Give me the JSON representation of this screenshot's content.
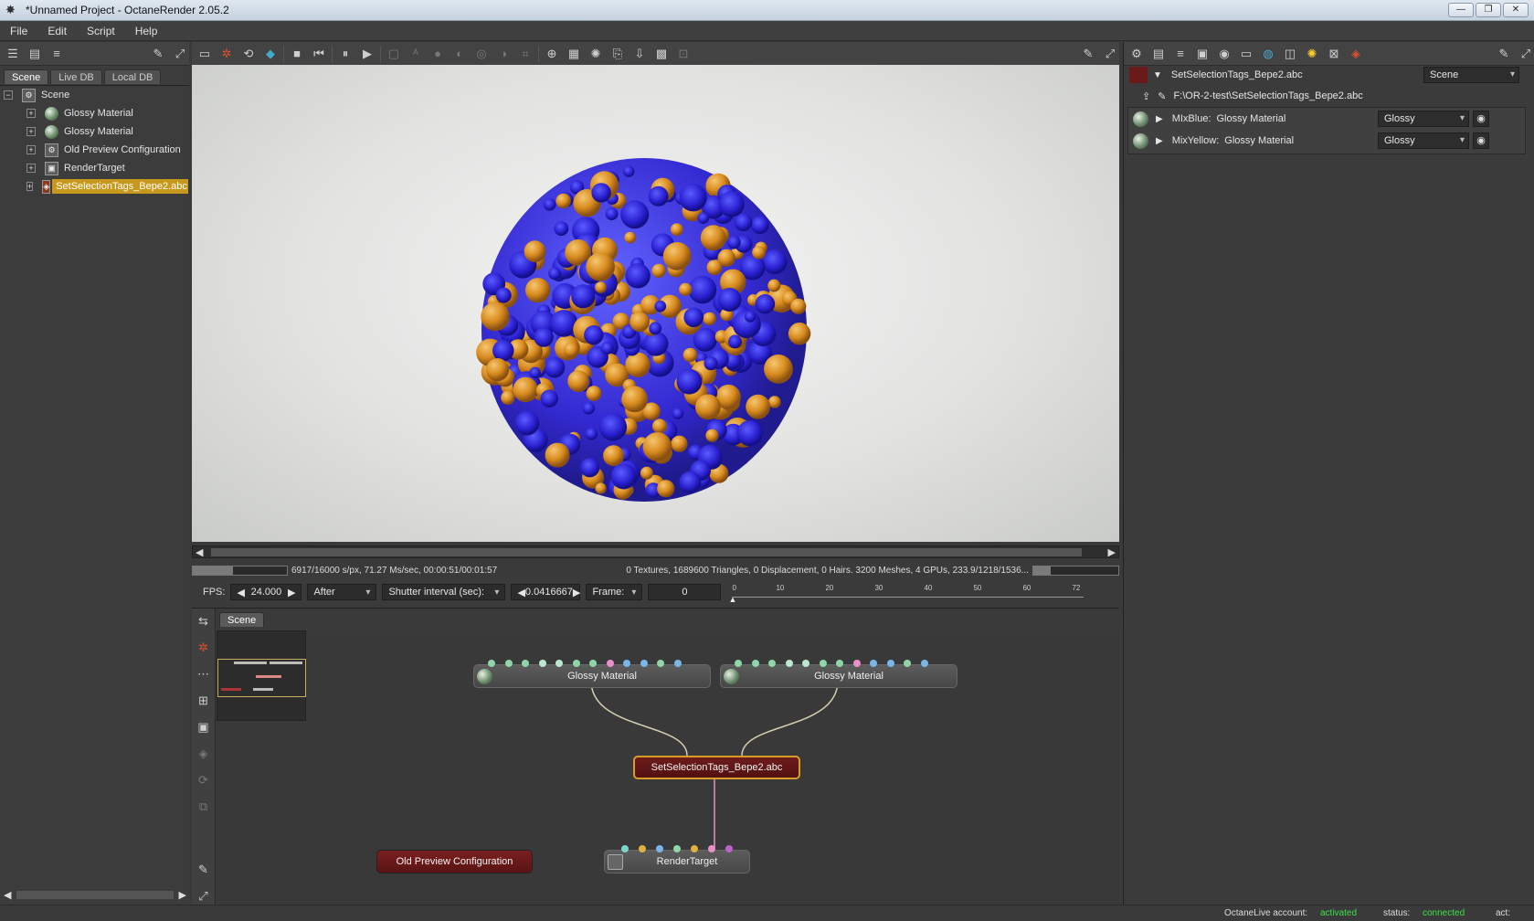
{
  "window": {
    "title": "*Unnamed Project - OctaneRender 2.05.2",
    "buttons": [
      "—",
      "❐",
      "✕"
    ]
  },
  "menu": [
    "File",
    "Edit",
    "Script",
    "Help"
  ],
  "left_panel": {
    "tabs": [
      "Scene",
      "Live DB",
      "Local DB"
    ],
    "tree": {
      "root": "Scene",
      "items": [
        {
          "label": "Glossy Material",
          "icon": "material-icon"
        },
        {
          "label": "Glossy Material",
          "icon": "material-icon"
        },
        {
          "label": "Old Preview Configuration",
          "icon": "config-icon"
        },
        {
          "label": "RenderTarget",
          "icon": "render-target-icon"
        },
        {
          "label": "SetSelectionTags_Bepe2.abc",
          "icon": "geometry-icon",
          "selected": true
        }
      ]
    }
  },
  "render": {
    "stats_left": "6917/16000 s/px, 71.27 Ms/sec, 00:00:51/00:01:57",
    "stats_right": "0 Textures, 1689600 Triangles, 0 Displacement, 0 Hairs. 3200 Meshes, 4 GPUs, 233.9/1218/1536...",
    "progress_fraction": 0.43
  },
  "controls": {
    "fps_label": "FPS:",
    "fps_value": "24.000",
    "after_label": "After",
    "shutter_label": "Shutter interval (sec):",
    "shutter_value": "0.0416667",
    "frame_label": "Frame:",
    "frame_value": "0",
    "timeline_ticks": [
      "0",
      "10",
      "20",
      "30",
      "40",
      "50",
      "60",
      "72"
    ]
  },
  "graph": {
    "tab": "Scene",
    "nodes": {
      "mat1": "Glossy Material",
      "mat2": "Glossy Material",
      "geometry": "SetSelectionTags_Bepe2.abc",
      "config": "Old Preview Configuration",
      "render_target": "RenderTarget"
    }
  },
  "right_panel": {
    "header_title": "SetSelectionTags_Bepe2.abc",
    "header_select": "Scene",
    "file_path": "F:\\OR-2-test\\SetSelectionTags_Bepe2.abc",
    "rows": [
      {
        "name": "MIxBlue:",
        "value": "Glossy Material",
        "type": "Glossy",
        "swatch": "#7a9a7a"
      },
      {
        "name": "MixYellow:",
        "value": "Glossy Material",
        "type": "Glossy",
        "swatch": "#7a9a7a"
      }
    ]
  },
  "status_bar": {
    "account_label": "OctaneLive account:",
    "account_value": "activated",
    "status_label": "status:",
    "status_value": "connected",
    "act_label": "act:"
  },
  "colors": {
    "accent_selected": "#c8981c",
    "status_green": "#3ee04a",
    "node_red": "#6e1c1c"
  }
}
